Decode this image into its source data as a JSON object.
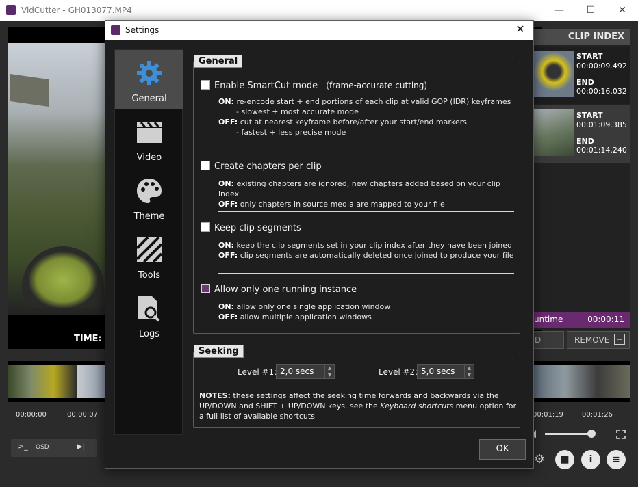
{
  "window": {
    "title": "VidCutter - GH013077.MP4",
    "minimize": "—",
    "maximize": "☐",
    "close": "✕"
  },
  "player": {
    "time_label": "TIME:  (",
    "timeline_ticks": [
      "00:00:00",
      "00:00:07",
      "00:01:19",
      "00:01:26"
    ]
  },
  "controls": {
    "console": ">_",
    "osd": "OSD",
    "next": "▶|"
  },
  "clip_index": {
    "title": "CLIP INDEX",
    "clips": [
      {
        "start_label": "START",
        "start": "00:00:09.492",
        "end_label": "END",
        "end": "00:00:16.032"
      },
      {
        "start_label": "START",
        "start": "00:01:09.385",
        "end_label": "END",
        "end": "00:01:14.240"
      }
    ],
    "runtime_label": "untime",
    "runtime_value": "00:00:11",
    "add_label": "D",
    "remove_label": "REMOVE",
    "remove_icon": "−"
  },
  "volume_level": 0.9,
  "dialog": {
    "title": "Settings",
    "close": "✕",
    "ok": "OK",
    "sidebar": [
      {
        "label": "General",
        "icon": "gear-icon"
      },
      {
        "label": "Video",
        "icon": "clapperboard-icon"
      },
      {
        "label": "Theme",
        "icon": "palette-icon"
      },
      {
        "label": "Tools",
        "icon": "tools-icon"
      },
      {
        "label": "Logs",
        "icon": "log-search-icon"
      }
    ],
    "general": {
      "title": "General",
      "smartcut": {
        "label": "Enable SmartCut mode",
        "sub": "(frame-accurate cutting)",
        "on_key": "ON:",
        "on": "re-encode start + end portions of each clip at valid GOP (IDR) keyframes",
        "on2": "- slowest + most accurate mode",
        "off_key": "OFF:",
        "off": "cut at nearest keyframe before/after your start/end markers",
        "off2": "- fastest + less precise mode",
        "checked": false
      },
      "chapters": {
        "label": "Create chapters per clip",
        "on_key": "ON:",
        "on": "existing chapters are ignored, new chapters added based on your clip index",
        "off_key": "OFF:",
        "off": "only chapters in source media are mapped to your file",
        "checked": false
      },
      "keep": {
        "label": "Keep clip segments",
        "on_key": "ON:",
        "on": "keep the clip segments set in your clip index after they have been joined",
        "off_key": "OFF:",
        "off": "clip segments are automatically deleted once joined to produce your file",
        "checked": false
      },
      "single": {
        "label": "Allow only one running instance",
        "on_key": "ON:",
        "on": "allow only one single application window",
        "off_key": "OFF:",
        "off": "allow multiple application windows",
        "checked": true
      }
    },
    "seeking": {
      "title": "Seeking",
      "level1_label": "Level #1:",
      "level1_value": "2,0 secs",
      "level2_label": "Level #2:",
      "level2_value": "5,0 secs",
      "notes_key": "NOTES:",
      "notes_a": " these settings affect the seeking time forwards and backwards via the UP/DOWN and SHIFT + UP/DOWN keys. see the ",
      "notes_em": "Keyboard shortcuts",
      "notes_b": " menu option for a full list of available shortcuts"
    }
  },
  "icons": {
    "settings": "gear-icon",
    "camera": "camera-icon",
    "info": "info-icon",
    "list": "list-icon",
    "fullscreen": "fullscreen-icon",
    "speaker": "speaker-icon"
  }
}
